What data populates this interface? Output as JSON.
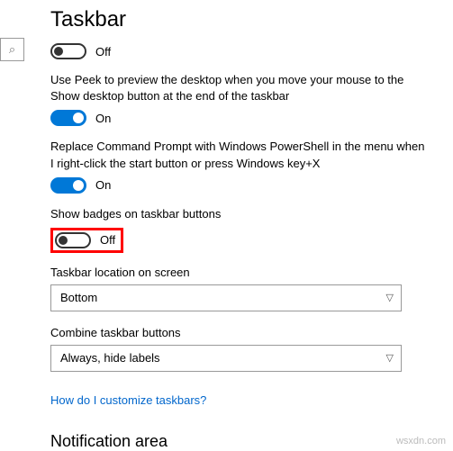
{
  "page_title": "Taskbar",
  "search_icon_glyph": "⌕",
  "toggle1": {
    "state": "off",
    "label": "Off"
  },
  "desc_peek": "Use Peek to preview the desktop when you move your mouse to the Show desktop button at the end of the taskbar",
  "toggle2": {
    "state": "on",
    "label": "On"
  },
  "desc_powershell": "Replace Command Prompt with Windows PowerShell in the menu when I right-click the start button or press Windows key+X",
  "toggle3": {
    "state": "on",
    "label": "On"
  },
  "desc_badges": "Show badges on taskbar buttons",
  "toggle4": {
    "state": "off",
    "label": "Off"
  },
  "location": {
    "label": "Taskbar location on screen",
    "value": "Bottom"
  },
  "combine": {
    "label": "Combine taskbar buttons",
    "value": "Always, hide labels"
  },
  "help_link": "How do I customize taskbars?",
  "section2": "Notification area",
  "watermark": "wsxdn.com"
}
